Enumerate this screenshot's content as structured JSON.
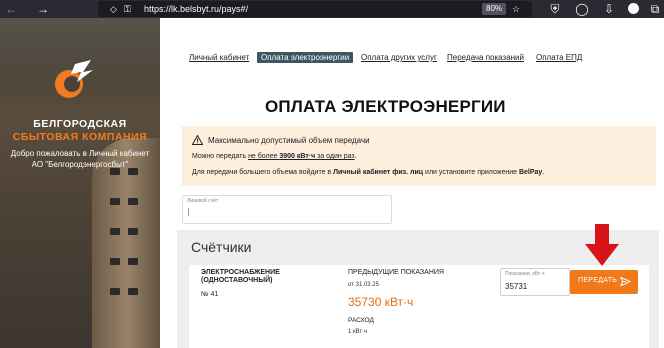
{
  "browser": {
    "url_host": "lk.belsbyt.ru",
    "url_path": "/pays#/",
    "url_scheme": "https://",
    "zoom": "80%"
  },
  "sidebar": {
    "brand_line1": "БЕЛГОРОДСКАЯ",
    "brand_line2": "СБЫТОВАЯ КОМПАНИЯ",
    "welcome_line1": "Добро пожаловать в Личный кабинет",
    "welcome_line2": "АО \"Белгородэнергосбыт\"",
    "colors": {
      "brand_orange": "#f37b1f"
    }
  },
  "nav": {
    "items": [
      {
        "label": "Личный кабинет",
        "active": false
      },
      {
        "label": "Оплата электроэнергии",
        "active": true
      },
      {
        "label": "Оплата других услуг",
        "active": false
      },
      {
        "label": "Передача показаний",
        "active": false
      },
      {
        "label": "Оплата ЕПД",
        "active": false
      }
    ]
  },
  "page": {
    "title": "ОПЛАТА ЭЛЕКТРОЭНЕРГИИ"
  },
  "warning": {
    "icon": "warning-triangle-icon",
    "title": "Максимально допустимый объем передачи",
    "line2_prefix": "Можно передать ",
    "line2_limit_prefix": "не более ",
    "line2_limit_value": "3900 кВт·ч",
    "line2_limit_suffix": " за один раз",
    "line2_end": ".",
    "line3_prefix": "Для передачи большего объема войдите в ",
    "line3_bold1": "Личный кабинет физ. лиц",
    "line3_middle": " или установите приложение ",
    "line3_bold2": "BelPay",
    "line3_end": ".",
    "colors": {
      "background": "#fdeede"
    }
  },
  "account": {
    "label": "Лицевой счёт",
    "value": ""
  },
  "meters": {
    "title": "Счётчики",
    "card": {
      "service_name": "ЭЛЕКТРОСНАБЖЕНИЕ (ОДНОСТАВОЧНЫЙ)",
      "number": "№ 41",
      "previous_label": "ПРЕДЫДУЩИЕ ПОКАЗАНИЯ",
      "previous_date": "от 31.03.25",
      "previous_value": "35730 кВт·ч",
      "consumption_label": "РАСХОД",
      "consumption_value": "1 кВт·ч",
      "reading_label": "Показания, кВт·ч",
      "reading_value": "35731",
      "send_label": "ПЕРЕДАТЬ",
      "send_icon": "send-icon"
    },
    "colors": {
      "accent": "#f07a1a",
      "value": "#e86d10"
    }
  },
  "annotation": {
    "icon": "red-arrow-down-icon",
    "color": "#d8141b"
  }
}
